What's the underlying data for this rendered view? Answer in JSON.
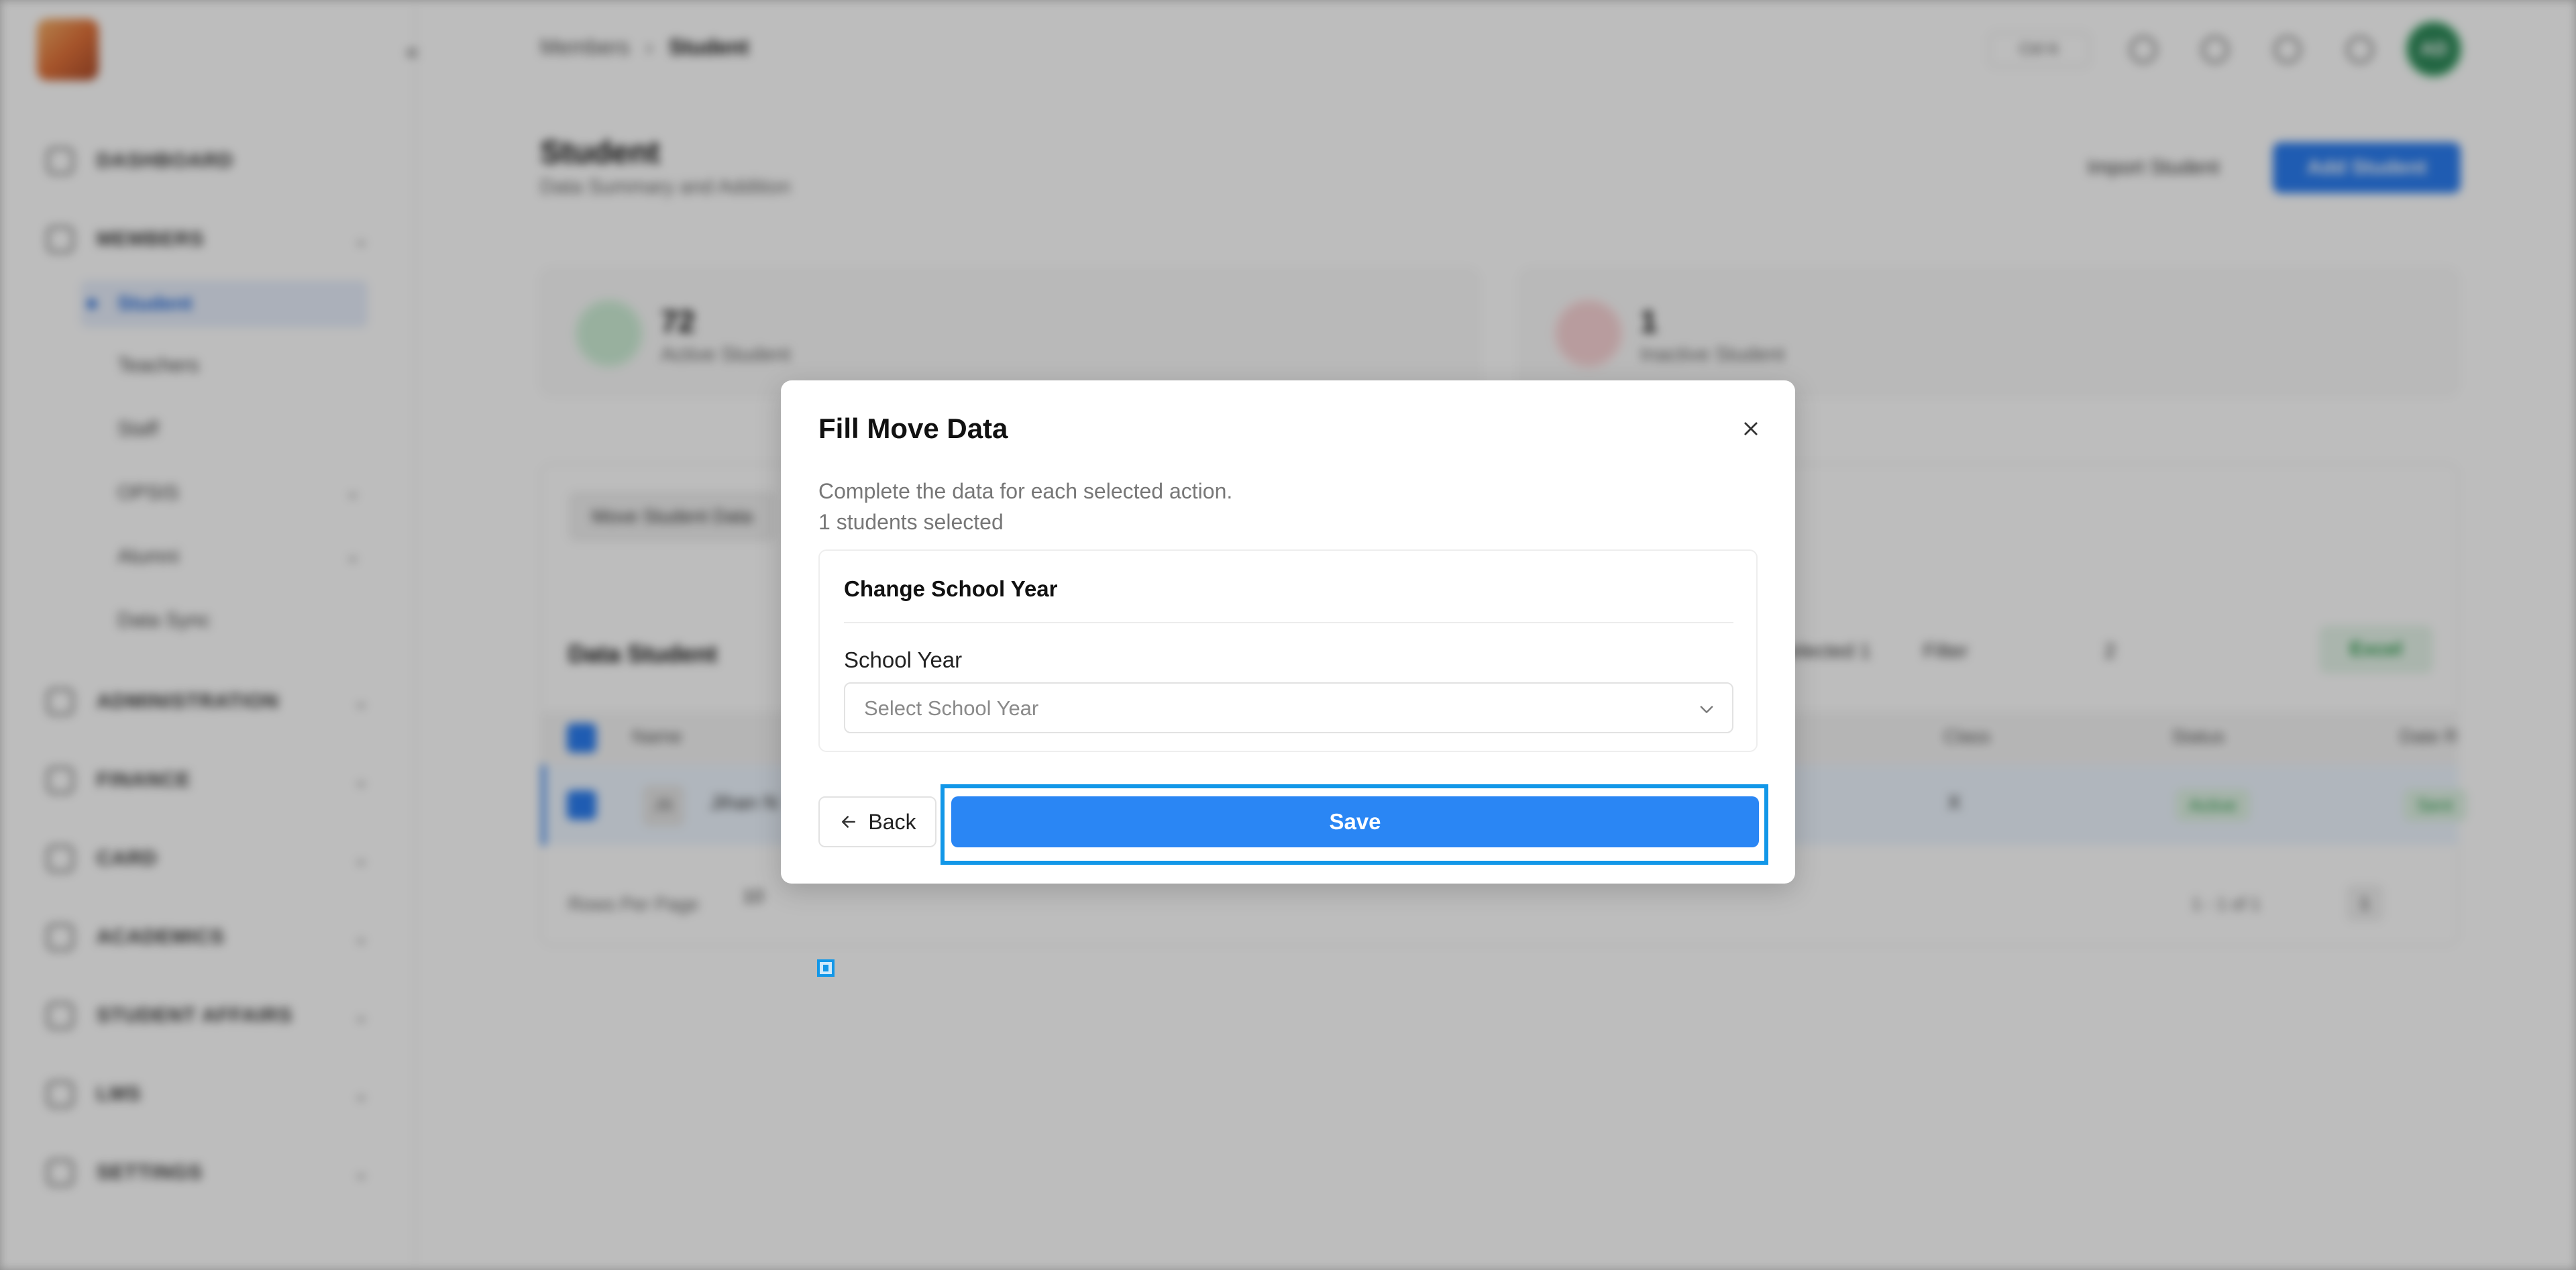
{
  "sidebar": {
    "items": [
      {
        "label": "DASHBOARD",
        "icon": "grid-icon",
        "has_chevron": false
      },
      {
        "label": "MEMBERS",
        "icon": "users-icon",
        "has_chevron": true
      },
      {
        "label": "ADMINISTRATION",
        "icon": "clipboard-icon",
        "has_chevron": true
      },
      {
        "label": "FINANCE",
        "icon": "wallet-icon",
        "has_chevron": true
      },
      {
        "label": "CARD",
        "icon": "card-icon",
        "has_chevron": true
      },
      {
        "label": "ACADEMICS",
        "icon": "book-icon",
        "has_chevron": true
      },
      {
        "label": "STUDENT AFFAIRS",
        "icon": "student-icon",
        "has_chevron": true
      },
      {
        "label": "LMS",
        "icon": "laptop-icon",
        "has_chevron": true
      },
      {
        "label": "SETTINGS",
        "icon": "gear-icon",
        "has_chevron": true
      }
    ],
    "members_sub": {
      "active": "Student",
      "items": [
        "Teachers",
        "Staff",
        "OPSIS",
        "Alumni",
        "Data Sync"
      ]
    },
    "chevron_glyph": "⌄"
  },
  "topbar": {
    "collapse_glyph": "«",
    "breadcrumb": {
      "parent": "Members",
      "separator": "›",
      "current": "Student"
    },
    "shortcut_pill": "Ctrl K",
    "avatar_initials": "AD"
  },
  "page": {
    "title": "Student",
    "subtitle": "Data Summary and Addition",
    "import_label": "Import Student",
    "add_label": "Add Student"
  },
  "stats": [
    {
      "value": "72",
      "label": "Active Student",
      "color": "#3aa85a"
    },
    {
      "value": "1",
      "label": "Inactive Student",
      "color": "#e0474c"
    }
  ],
  "table": {
    "move_label": "Move Student Data",
    "title": "Data Student",
    "selected_label": "Selected 1",
    "filter_label": "Filter",
    "search_value": "2",
    "excel_label": "Excel",
    "columns": [
      "Name",
      "Class",
      "Status",
      "Date R"
    ],
    "row": {
      "avatar": "JS",
      "name": "Jihan N",
      "class": "X",
      "status": "Active",
      "date": "Sent"
    },
    "rows_per_page_label": "Rows Per Page",
    "rows_per_page_value": "10",
    "range_label": "1 - 1 of 1",
    "current_page": "1"
  },
  "modal": {
    "title": "Fill Move Data",
    "description": "Complete the data for each selected action.",
    "selected_count": "1 students selected",
    "section_title": "Change School Year",
    "field_label": "School Year",
    "select_placeholder": "Select School Year",
    "back_label": "Back",
    "save_label": "Save"
  },
  "colors": {
    "primary": "#2a86f4",
    "focus_ring": "#1297e8",
    "overlay": "rgba(0,0,0,0.26)"
  }
}
